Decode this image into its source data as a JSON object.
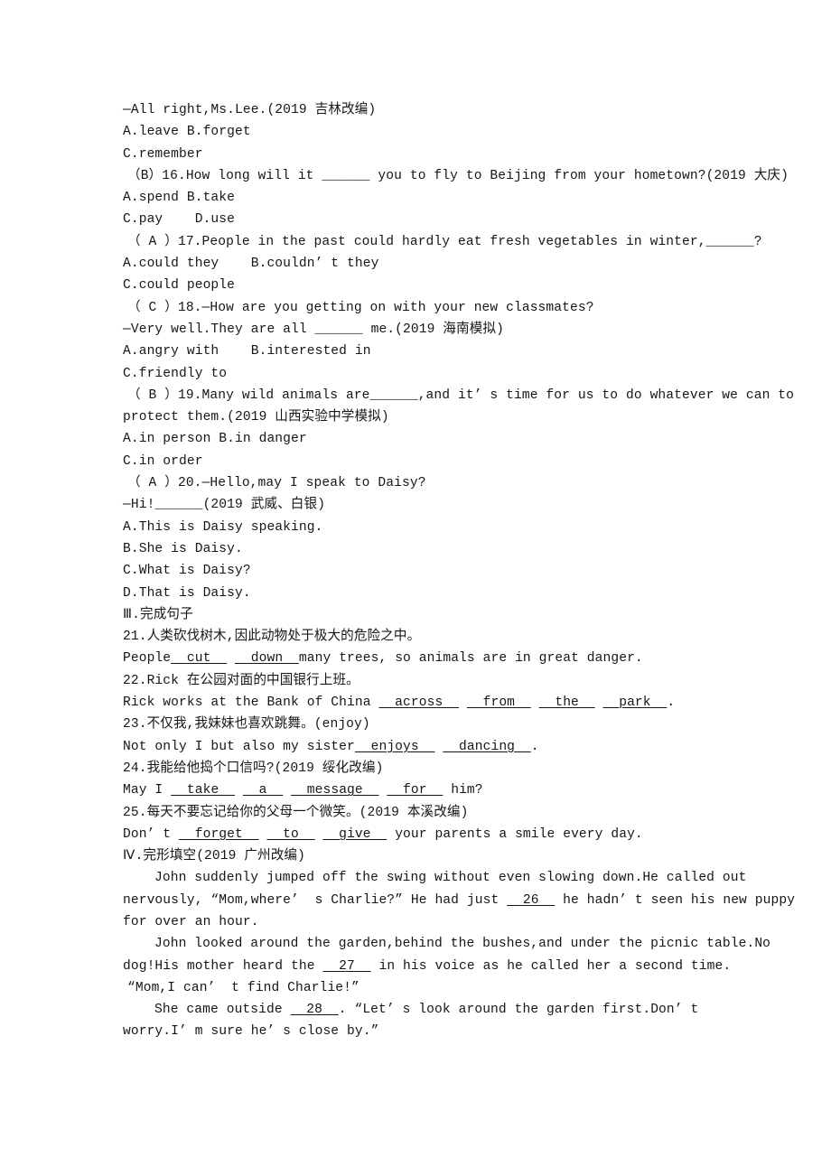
{
  "document": {
    "kind": "english-exam-worksheet",
    "text_color": "#161616",
    "background_color": "#ffffff"
  },
  "blocks": [
    {
      "id": "l1",
      "indent": "none",
      "text": "—All right,Ms.Lee.(2019 吉林改编)"
    },
    {
      "id": "l2",
      "indent": "none",
      "text": "A.leave B.forget"
    },
    {
      "id": "l3",
      "indent": "none",
      "text": "C.remember"
    },
    {
      "id": "l4",
      "indent": "q",
      "text": "（B）16.How long will it ______ you to fly to Beijing from your hometown?(2019 大庆)"
    },
    {
      "id": "l5",
      "indent": "none",
      "text": "A.spend B.take"
    },
    {
      "id": "l6",
      "indent": "none",
      "text": "C.pay    D.use"
    },
    {
      "id": "l7",
      "indent": "q",
      "text": "（ A ）17.People in the past could hardly eat fresh vegetables in winter,______?"
    },
    {
      "id": "l8",
      "indent": "none",
      "text": "A.could they    B.couldn’ t they"
    },
    {
      "id": "l9",
      "indent": "none",
      "text": "C.could people"
    },
    {
      "id": "l10",
      "indent": "q",
      "text": "（ C ）18.—How are you getting on with your new classmates?"
    },
    {
      "id": "l11",
      "indent": "none",
      "text": "—Very well.They are all ______ me.(2019 海南模拟)"
    },
    {
      "id": "l12",
      "indent": "none",
      "text": "A.angry with    B.interested in"
    },
    {
      "id": "l13",
      "indent": "none",
      "text": "C.friendly to"
    },
    {
      "id": "l14",
      "indent": "q",
      "text": "（ B ）19.Many wild animals are______,and it’ s time for us to do whatever we can to"
    },
    {
      "id": "l15",
      "indent": "none",
      "text": "protect them.(2019 山西实验中学模拟)"
    },
    {
      "id": "l16",
      "indent": "none",
      "text": "A.in person B.in danger"
    },
    {
      "id": "l17",
      "indent": "none",
      "text": "C.in order"
    },
    {
      "id": "l18",
      "indent": "q",
      "text": "（ A ）20.—Hello,may I speak to Daisy?"
    },
    {
      "id": "l19",
      "indent": "none",
      "text": "—Hi!______(2019 武威、白银)"
    },
    {
      "id": "l20",
      "indent": "none",
      "text": "A.This is Daisy speaking."
    },
    {
      "id": "l21",
      "indent": "none",
      "text": "B.She is Daisy."
    },
    {
      "id": "l22",
      "indent": "none",
      "text": "C.What is Daisy?"
    },
    {
      "id": "l23",
      "indent": "none",
      "text": "D.That is Daisy."
    },
    {
      "id": "l24",
      "indent": "none",
      "text": "Ⅲ.完成句子"
    },
    {
      "id": "l25",
      "indent": "none",
      "text": "21.人类砍伐树木,因此动物处于极大的危险之中。"
    },
    {
      "id": "l26",
      "indent": "none",
      "segments": [
        {
          "t": "People",
          "style": "plain"
        },
        {
          "t": "  cut  ",
          "style": "answer"
        },
        {
          "t": " ",
          "style": "plain"
        },
        {
          "t": "  down  ",
          "style": "answer"
        },
        {
          "t": "many trees, so animals are in great danger.",
          "style": "plain"
        }
      ]
    },
    {
      "id": "l27",
      "indent": "none",
      "text": "22.Rick 在公园对面的中国银行上班。"
    },
    {
      "id": "l28",
      "indent": "none",
      "segments": [
        {
          "t": "Rick works at the Bank of China ",
          "style": "plain"
        },
        {
          "t": "  across  ",
          "style": "answer"
        },
        {
          "t": " ",
          "style": "plain"
        },
        {
          "t": "  from  ",
          "style": "answer"
        },
        {
          "t": " ",
          "style": "plain"
        },
        {
          "t": "  the  ",
          "style": "answer"
        },
        {
          "t": " ",
          "style": "plain"
        },
        {
          "t": "  park  ",
          "style": "answer"
        },
        {
          "t": ".",
          "style": "plain"
        }
      ]
    },
    {
      "id": "l29",
      "indent": "none",
      "text": "23.不仅我,我妹妹也喜欢跳舞。(enjoy)"
    },
    {
      "id": "l30",
      "indent": "none",
      "segments": [
        {
          "t": "Not only I but also my sister",
          "style": "plain"
        },
        {
          "t": "  enjoys  ",
          "style": "answer"
        },
        {
          "t": " ",
          "style": "plain"
        },
        {
          "t": "  dancing  ",
          "style": "answer"
        },
        {
          "t": ".",
          "style": "plain"
        }
      ]
    },
    {
      "id": "l31",
      "indent": "none",
      "text": "24.我能给他捣个口信吗?(2019 绥化改编)"
    },
    {
      "id": "l32",
      "indent": "none",
      "segments": [
        {
          "t": "May I ",
          "style": "plain"
        },
        {
          "t": "  take  ",
          "style": "answer"
        },
        {
          "t": " ",
          "style": "plain"
        },
        {
          "t": "  a  ",
          "style": "answer"
        },
        {
          "t": " ",
          "style": "plain"
        },
        {
          "t": "  message  ",
          "style": "answer"
        },
        {
          "t": " ",
          "style": "plain"
        },
        {
          "t": "  for  ",
          "style": "answer"
        },
        {
          "t": " him?",
          "style": "plain"
        }
      ]
    },
    {
      "id": "l33",
      "indent": "none",
      "text": "25.每天不要忘记给你的父母一个微笑。(2019 本溪改编)"
    },
    {
      "id": "l34",
      "indent": "none",
      "segments": [
        {
          "t": "Don’ t ",
          "style": "plain"
        },
        {
          "t": "  forget  ",
          "style": "answer"
        },
        {
          "t": " ",
          "style": "plain"
        },
        {
          "t": "  to  ",
          "style": "answer"
        },
        {
          "t": " ",
          "style": "plain"
        },
        {
          "t": "  give  ",
          "style": "answer"
        },
        {
          "t": " your parents a smile every day.",
          "style": "plain"
        }
      ]
    },
    {
      "id": "l35",
      "indent": "none",
      "text": "Ⅳ.完形填空(2019 广州改编)"
    },
    {
      "id": "l36",
      "indent": "para",
      "text": "John suddenly jumped off the swing without even slowing down.He called out"
    },
    {
      "id": "l37",
      "indent": "none",
      "segments": [
        {
          "t": "nervously, “Mom,where’  s Charlie?” He had just ",
          "style": "plain"
        },
        {
          "t": "  26  ",
          "style": "answer"
        },
        {
          "t": " he hadn’ t seen his new puppy",
          "style": "plain"
        }
      ]
    },
    {
      "id": "l38",
      "indent": "none",
      "text": "for over an hour."
    },
    {
      "id": "l39",
      "indent": "para",
      "text": "John looked around the garden,behind the bushes,and under the picnic table.No"
    },
    {
      "id": "l40",
      "indent": "none",
      "segments": [
        {
          "t": "dog!His mother heard the ",
          "style": "plain"
        },
        {
          "t": "  27  ",
          "style": "answer"
        },
        {
          "t": " in his voice as he called her a second time.",
          "style": "plain"
        }
      ]
    },
    {
      "id": "l41",
      "indent": "quote",
      "text": "“Mom,I can’  t find Charlie!”"
    },
    {
      "id": "l42",
      "indent": "para",
      "segments": [
        {
          "t": "She came outside ",
          "style": "plain"
        },
        {
          "t": "  28  ",
          "style": "answer"
        },
        {
          "t": ". “Let’ s look around the garden first.Don’ t",
          "style": "plain"
        }
      ]
    },
    {
      "id": "l43",
      "indent": "none",
      "text": "worry.I’ m sure he’ s close by.”"
    }
  ]
}
